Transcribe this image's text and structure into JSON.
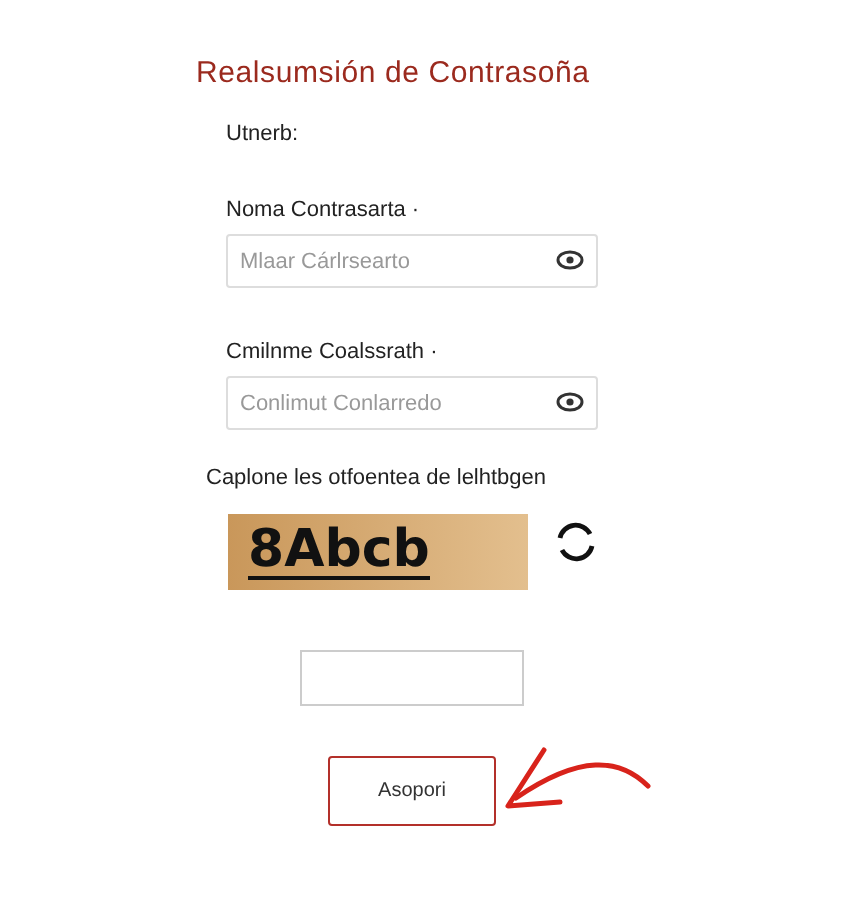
{
  "title": "Realsumsión de Contrasoña",
  "subtitle": "Utnerb:",
  "fields": [
    {
      "label": "Noma Contrasarta ·",
      "placeholder": "Mlaar Cárlrsearto"
    },
    {
      "label": "Cmilnme Coalssrath ·",
      "placeholder": "Conlimut Conlarredo"
    }
  ],
  "captcha": {
    "label": "Caplone les otfoentea de lelhtbgen",
    "code": "8Abcb"
  },
  "button": "Asopori"
}
